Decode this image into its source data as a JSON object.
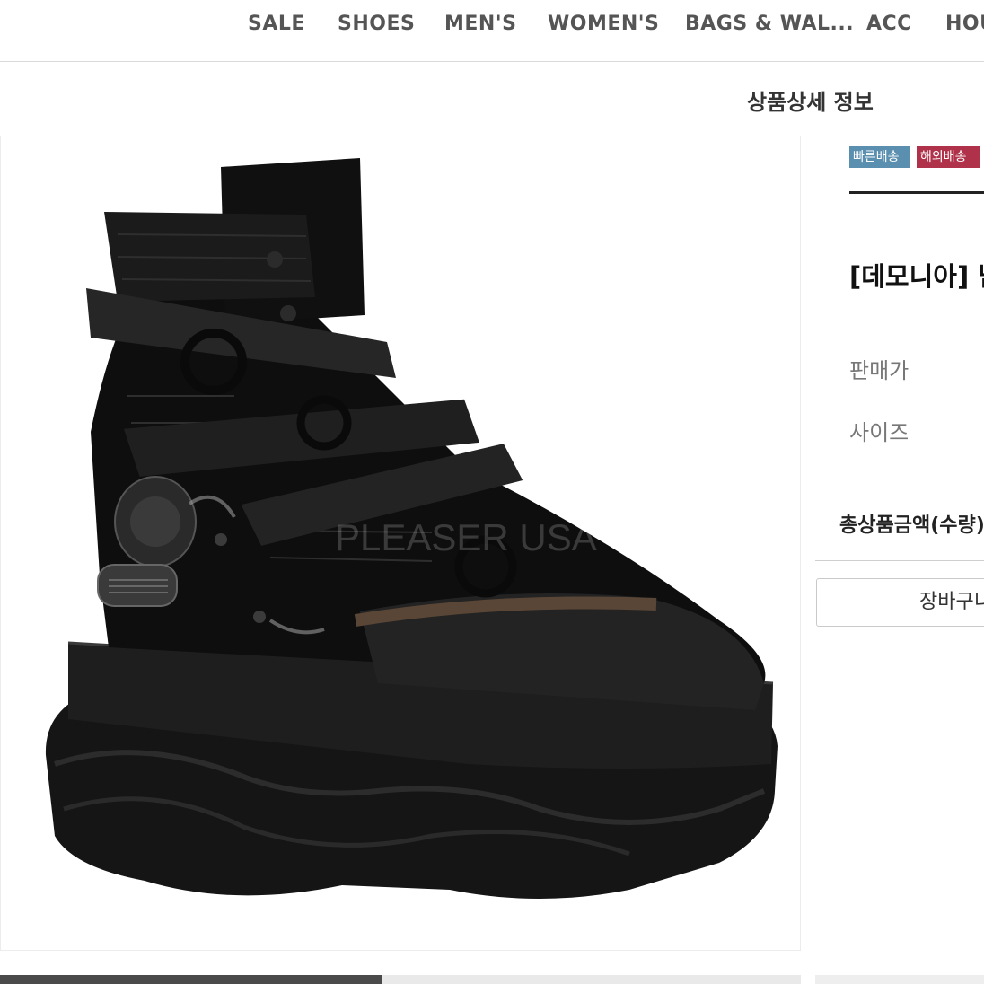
{
  "nav": {
    "items": [
      "SALE",
      "SHOES",
      "MEN'S",
      "WOMEN'S",
      "BAGS & WAL...",
      "ACC",
      "HOU"
    ]
  },
  "section_title": "상품상세 정보",
  "product_image": {
    "watermark": "PLEASER USA"
  },
  "badges": {
    "fast_shipping": "빠른배송",
    "overseas_shipping": "해외배송"
  },
  "product": {
    "name": "[데모니아] 남"
  },
  "fields": {
    "price_label": "판매가",
    "size_label": "사이즈"
  },
  "total": {
    "label": "총상품금액(수량)"
  },
  "actions": {
    "cart_label": "장바구니"
  },
  "colors": {
    "fast_badge": "#5b8fb0",
    "overseas_badge": "#b0324a"
  }
}
